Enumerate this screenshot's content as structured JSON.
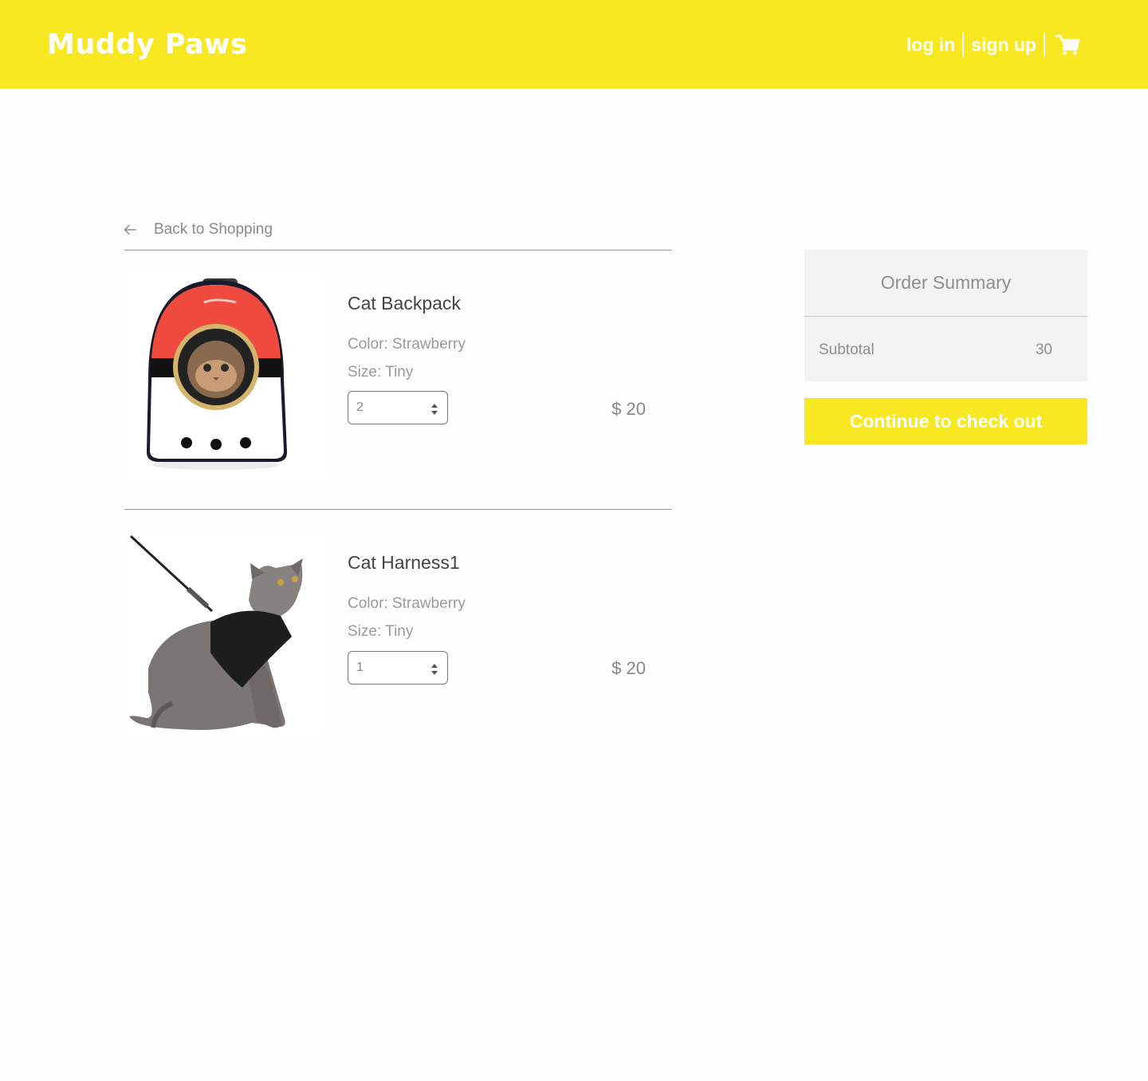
{
  "brand": {
    "name": "Muddy Paws",
    "accent": "#f8e821"
  },
  "nav": {
    "login": "log in",
    "signup": "sign up",
    "cart_icon": "cart-icon"
  },
  "back": {
    "label": "Back to Shopping",
    "icon": "arrow-left-icon"
  },
  "items": [
    {
      "name": "Cat Backpack",
      "color": "Color: Strawberry",
      "size": "Size: Tiny",
      "quantity": "2",
      "price": "$ 20"
    },
    {
      "name": "Cat Harness1",
      "color": "Color: Strawberry",
      "size": "Size: Tiny",
      "quantity": "1",
      "price": "$ 20"
    }
  ],
  "summary": {
    "title": "Order Summary",
    "subtotal_label": "Subtotal",
    "subtotal_value": "30"
  },
  "checkout": {
    "label": "Continue to check out"
  }
}
